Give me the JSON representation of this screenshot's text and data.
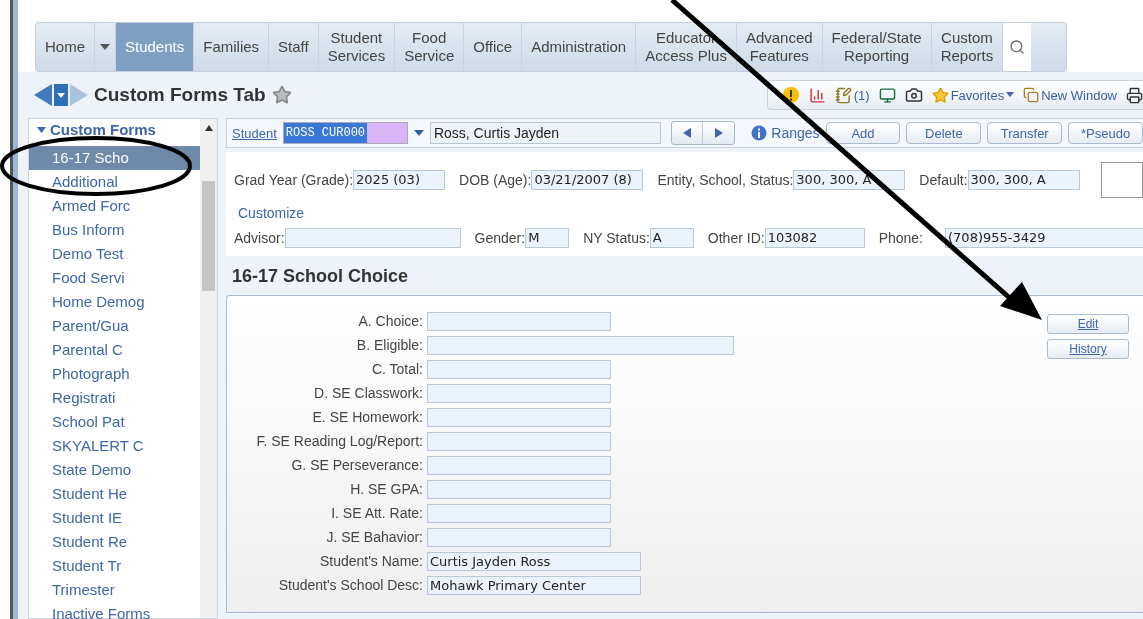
{
  "nav": {
    "tabs": [
      {
        "label": "Home",
        "selected": false
      },
      {
        "label": "Students",
        "selected": true
      },
      {
        "label": "Families",
        "selected": false
      },
      {
        "label": "Staff",
        "selected": false
      },
      {
        "label": "Student\nServices",
        "selected": false
      },
      {
        "label": "Food\nService",
        "selected": false
      },
      {
        "label": "Office",
        "selected": false
      },
      {
        "label": "Administration",
        "selected": false
      },
      {
        "label": "Educator\nAccess Plus",
        "selected": false
      },
      {
        "label": "Advanced\nFeatures",
        "selected": false
      },
      {
        "label": "Federal/State\nReporting",
        "selected": false
      },
      {
        "label": "Custom\nReports",
        "selected": false
      }
    ]
  },
  "page_title": "Custom Forms Tab",
  "toolbar": [
    {
      "kind": "alert"
    },
    {
      "kind": "report"
    },
    {
      "kind": "notes",
      "label": "(1)"
    },
    {
      "kind": "monitor"
    },
    {
      "kind": "camera"
    },
    {
      "kind": "favorites",
      "label": "Favorites"
    },
    {
      "kind": "new-window",
      "label": "New Window"
    },
    {
      "kind": "print"
    }
  ],
  "sidebar": {
    "header": "Custom Forms",
    "items": [
      {
        "label": "16-17 Scho",
        "selected": true
      },
      {
        "label": "Additional",
        "selected": false
      },
      {
        "label": "Armed Forc",
        "selected": false
      },
      {
        "label": "Bus Inform",
        "selected": false
      },
      {
        "label": "Demo Test",
        "selected": false
      },
      {
        "label": "Food Servi",
        "selected": false
      },
      {
        "label": "Home Demog",
        "selected": false
      },
      {
        "label": "Parent/Gua",
        "selected": false
      },
      {
        "label": "Parental C",
        "selected": false
      },
      {
        "label": "Photograph",
        "selected": false
      },
      {
        "label": "Registrati",
        "selected": false
      },
      {
        "label": "School Pat",
        "selected": false
      },
      {
        "label": "SKYALERT C",
        "selected": false
      },
      {
        "label": "State Demo",
        "selected": false
      },
      {
        "label": "Student He",
        "selected": false
      },
      {
        "label": "Student IE",
        "selected": false
      },
      {
        "label": "Student Re",
        "selected": false
      },
      {
        "label": "Student Tr",
        "selected": false
      },
      {
        "label": "Trimester",
        "selected": false
      },
      {
        "label": "Inactive Forms",
        "selected": false
      }
    ]
  },
  "student_bar": {
    "label": "Student",
    "id": "ROSS CUR000",
    "name": "Ross, Curtis Jayden",
    "ranges": "Ranges",
    "buttons": [
      "Add",
      "Delete",
      "Transfer",
      "*Pseudo"
    ]
  },
  "info": {
    "row_1": [
      {
        "label": "Grad Year (Grade):",
        "value": "2025 (03)"
      },
      {
        "label": "DOB (Age):",
        "value": "03/21/2007 (8)"
      },
      {
        "label": "Entity, School, Status:",
        "value": "300, 300, A"
      },
      {
        "label": "Default:",
        "value": "300, 300, A"
      }
    ],
    "customize": "Customize",
    "row_2": [
      {
        "label": "Advisor:"
      },
      {
        "label": "Gender:",
        "value": "M"
      },
      {
        "label": "NY Status:",
        "value": "A"
      },
      {
        "label": "Other ID:",
        "value": "103082"
      },
      {
        "label": "Phone:",
        "value": "(708)955-3429"
      }
    ]
  },
  "section": {
    "title": "16-17 School Choice",
    "fields": [
      {
        "label": "A. Choice:"
      },
      {
        "label": "B. Eligible:"
      },
      {
        "label": "C. Total:"
      },
      {
        "label": "D. SE Classwork:"
      },
      {
        "label": "E. SE Homework:"
      },
      {
        "label": "F. SE Reading Log/Report:"
      },
      {
        "label": "G. SE Perseverance:"
      },
      {
        "label": "H. SE GPA:"
      },
      {
        "label": "I. SE Att. Rate:"
      },
      {
        "label": "J. SE Bahavior:"
      },
      {
        "label": "Student's Name:",
        "value": "Curtis Jayden Ross"
      },
      {
        "label": "Student's School Desc:",
        "value": "Mohawk Primary Center"
      }
    ],
    "buttons": [
      "Edit",
      "History"
    ]
  },
  "highlight_ellipse": true,
  "pointer_arrow": true
}
